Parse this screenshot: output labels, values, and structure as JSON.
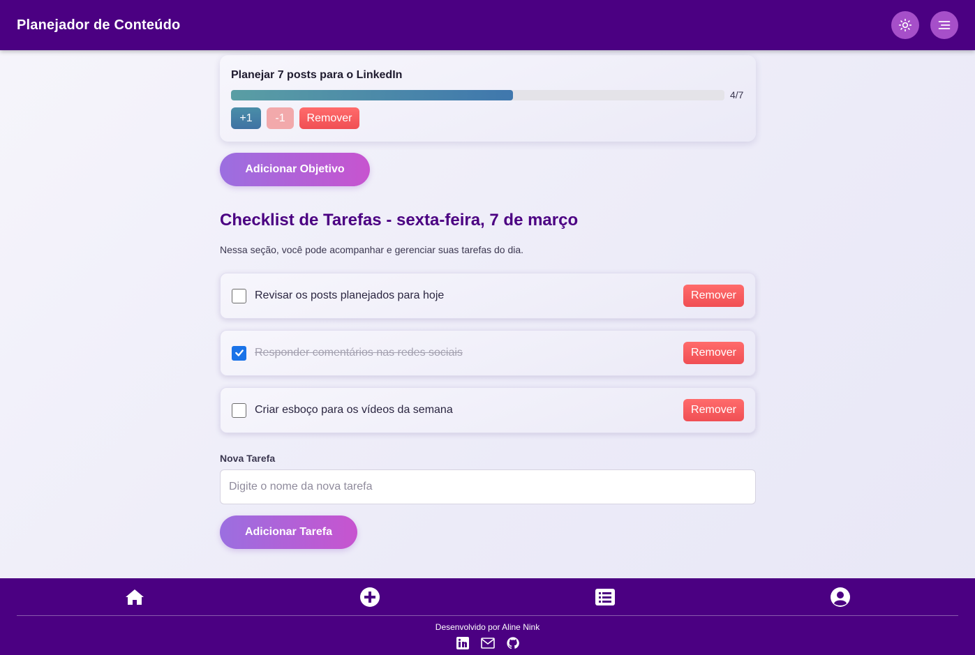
{
  "header": {
    "title": "Planejador de Conteúdo",
    "theme_toggle_icon": "sun-icon",
    "menu_icon": "menu-icon"
  },
  "goal": {
    "title": "Planejar 7 posts para o LinkedIn",
    "progress_current": 4,
    "progress_total": 7,
    "progress_label": "4/7",
    "plus_label": "+1",
    "minus_label": "-1",
    "remove_label": "Remover"
  },
  "add_goal_button": "Adicionar Objetivo",
  "checklist": {
    "title": "Checklist de Tarefas - sexta-feira, 7 de março",
    "description": "Nessa seção, você pode acompanhar e gerenciar suas tarefas do dia.",
    "tasks": [
      {
        "text": "Revisar os posts planejados para hoje",
        "done": false,
        "remove_label": "Remover"
      },
      {
        "text": "Responder comentários nas redes sociais",
        "done": true,
        "remove_label": "Remover"
      },
      {
        "text": "Criar esboço para os vídeos da semana",
        "done": false,
        "remove_label": "Remover"
      }
    ]
  },
  "new_task": {
    "label": "Nova Tarefa",
    "placeholder": "Digite o nome da nova tarefa",
    "value": "",
    "button": "Adicionar Tarefa"
  },
  "footer": {
    "nav": [
      "home-icon",
      "add-circle-icon",
      "list-icon",
      "user-circle-icon"
    ],
    "credit": "Desenvolvido por Aline Nink",
    "social": [
      "linkedin-icon",
      "mail-icon",
      "github-icon"
    ]
  },
  "colors": {
    "primary": "#4b0082",
    "accent_purple": "#a64fc9",
    "danger": "#f04f54",
    "progress": "#3f77ad"
  }
}
